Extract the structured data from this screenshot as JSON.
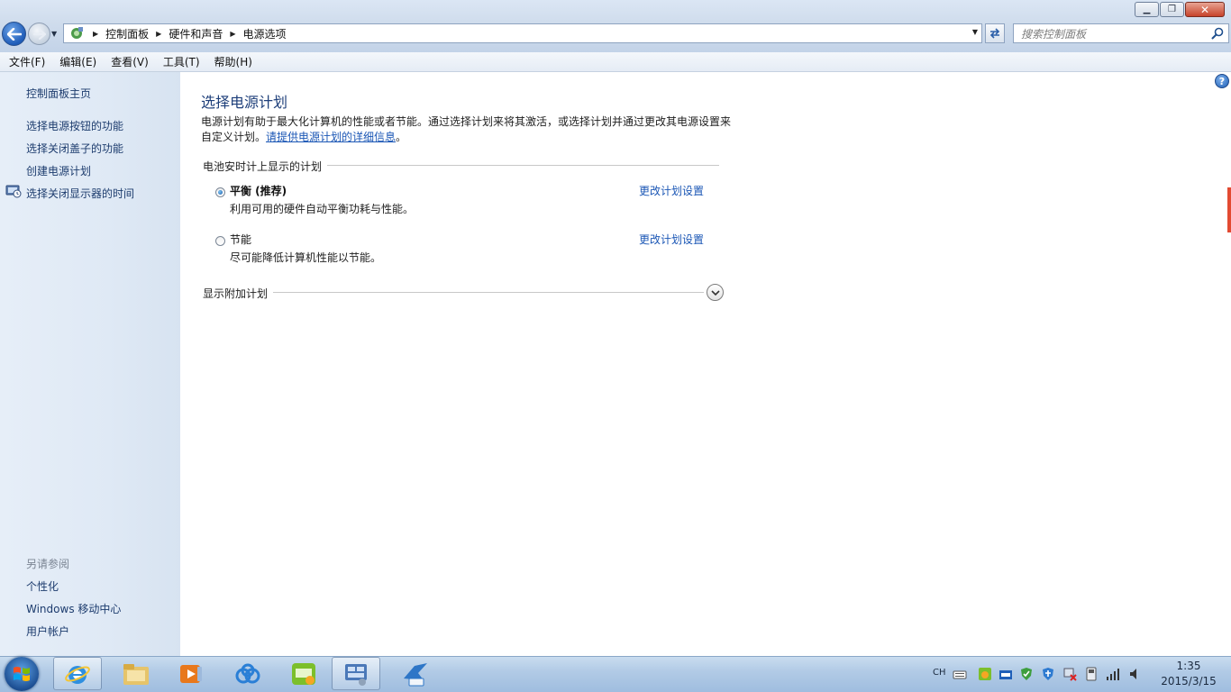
{
  "window": {
    "minimize_glyph": "▁",
    "maximize_glyph": "❐",
    "close_glyph": "✕"
  },
  "address": {
    "crumbs": [
      "控制面板",
      "硬件和声音",
      "电源选项"
    ],
    "search_placeholder": "搜索控制面板"
  },
  "menu": [
    "文件(F)",
    "编辑(E)",
    "查看(V)",
    "工具(T)",
    "帮助(H)"
  ],
  "sidebar": {
    "home": "控制面板主页",
    "links": [
      "选择电源按钮的功能",
      "选择关闭盖子的功能",
      "创建电源计划",
      "选择关闭显示器的时间"
    ],
    "see_also_heading": "另请参阅",
    "see_also": [
      "个性化",
      "Windows 移动中心",
      "用户帐户"
    ]
  },
  "main": {
    "title": "选择电源计划",
    "desc_part1": "电源计划有助于最大化计算机的性能或者节能。通过选择计划来将其激活，或选择计划并通过更改其电源设置来自定义计划。",
    "desc_link": "请提供电源计划的详细信息",
    "desc_end": "。",
    "group_label": "电池安时计上显示的计划",
    "plans": [
      {
        "name": "平衡 (推荐)",
        "desc": "利用可用的硬件自动平衡功耗与性能。",
        "link": "更改计划设置",
        "selected": true
      },
      {
        "name": "节能",
        "desc": "尽可能降低计算机性能以节能。",
        "link": "更改计划设置",
        "selected": false
      }
    ],
    "more_label": "显示附加计划",
    "help_glyph": "?"
  },
  "taskbar": {
    "lang": "CH",
    "time": "1:35",
    "date": "2015/3/15"
  },
  "colors": {
    "link": "#1a56b5",
    "title": "#1e3f7a",
    "accent_scroll": "#e24a32"
  }
}
